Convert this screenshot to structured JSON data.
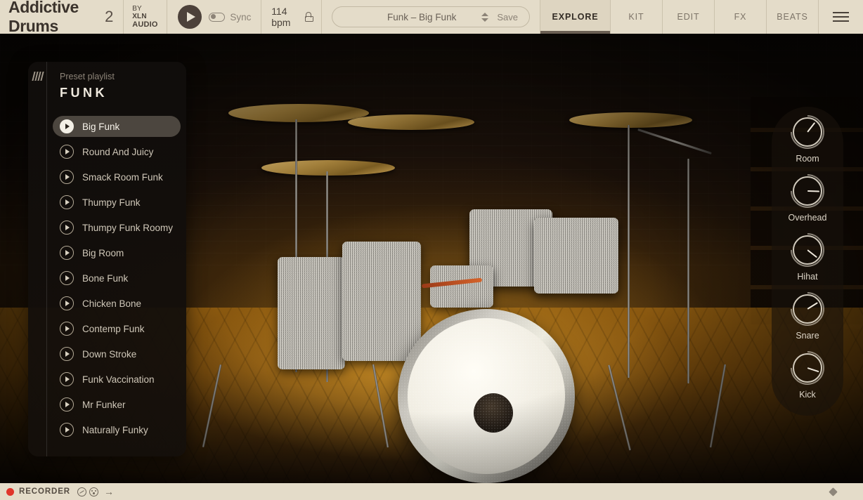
{
  "header": {
    "brand_name": "Addictive Drums",
    "brand_version": "2",
    "by_line1_prefix": "BY ",
    "by_line1_bold": "XLN",
    "by_line2": "AUDIO",
    "play_icon": "play-icon",
    "sync_label": "Sync",
    "sync_enabled": false,
    "bpm": "114 bpm",
    "lock_icon": "unlocked-padlock-icon",
    "preset_name": "Funk – Big Funk",
    "preset_stepper_icon": "chevron-up-down-icon",
    "save_label": "Save",
    "tabs": [
      {
        "label": "EXPLORE",
        "active": true
      },
      {
        "label": "KIT",
        "active": false
      },
      {
        "label": "EDIT",
        "active": false
      },
      {
        "label": "FX",
        "active": false
      },
      {
        "label": "BEATS",
        "active": false
      }
    ],
    "menu_icon": "hamburger-menu-icon"
  },
  "sidebar": {
    "grip_icon": "drag-handle-icon",
    "kicker": "Preset playlist",
    "title": "FUNK",
    "presets": [
      {
        "name": "Big Funk",
        "selected": true
      },
      {
        "name": "Round And Juicy",
        "selected": false
      },
      {
        "name": "Smack Room Funk",
        "selected": false
      },
      {
        "name": "Thumpy Funk",
        "selected": false
      },
      {
        "name": "Thumpy Funk Roomy",
        "selected": false
      },
      {
        "name": "Big Room",
        "selected": false
      },
      {
        "name": "Bone Funk",
        "selected": false
      },
      {
        "name": "Chicken Bone",
        "selected": false
      },
      {
        "name": "Contemp Funk",
        "selected": false
      },
      {
        "name": "Down Stroke",
        "selected": false
      },
      {
        "name": "Funk Vaccination",
        "selected": false
      },
      {
        "name": "Mr Funker",
        "selected": false
      },
      {
        "name": "Naturally Funky",
        "selected": false
      }
    ]
  },
  "mixer_rack": {
    "knobs": [
      {
        "label": "Room",
        "angle": 38
      },
      {
        "label": "Overhead",
        "angle": 92
      },
      {
        "label": "Hihat",
        "angle": 128
      },
      {
        "label": "Snare",
        "angle": 58
      },
      {
        "label": "Kick",
        "angle": 108
      }
    ]
  },
  "recorder": {
    "record_indicator": "record-dot",
    "label": "RECORDER",
    "icon_1": "tape-icon",
    "icon_2": "reel-icon",
    "arrow_icon": "arrow-right-icon",
    "resize_grip_icon": "resize-grip-icon"
  },
  "colors": {
    "chrome": "#e4dcc9",
    "accent_dark": "#4c413a",
    "record_red": "#e0352b",
    "stage_gold": "#8a5e10"
  }
}
